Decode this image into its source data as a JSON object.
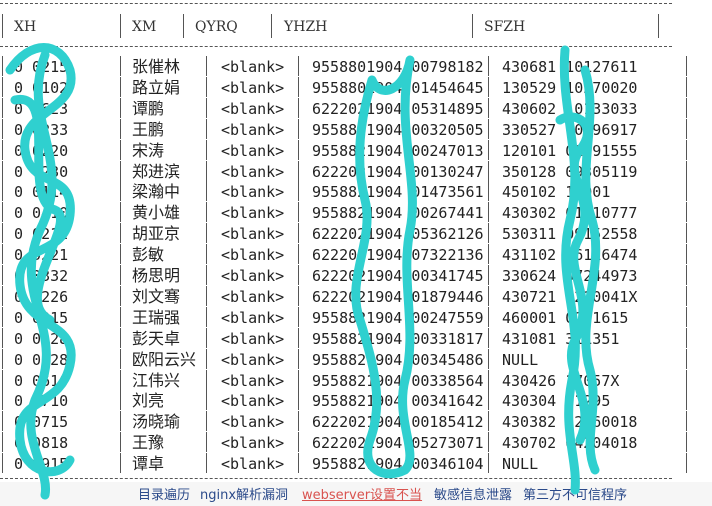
{
  "table": {
    "headers": [
      "XH",
      "XM",
      "QYRQ",
      "YHZH",
      "SFZH"
    ],
    "rows": [
      [
        "0  0215",
        "张催林",
        "<blank>",
        "9558801904 00798182",
        "430681   10127611"
      ],
      [
        "0  0102",
        "路立娟",
        "<blank>",
        "9558801904 01454645",
        "130529   10270020"
      ],
      [
        "0  0623",
        "谭鹏",
        "<blank>",
        "6222021904 05314895",
        "430602   10133033"
      ],
      [
        "0  0233",
        "王鹏",
        "<blank>",
        "9558821904 00320505",
        "330527   10296917"
      ],
      [
        "0  0220",
        "宋涛",
        "<blank>",
        "9558821904 00247013",
        "120101   01291555"
      ],
      [
        "0  0230",
        "郑进滨",
        "<blank>",
        "6222021904 00130247",
        "350128   09305119"
      ],
      [
        "0  0114",
        "梁瀚中",
        "<blank>",
        "9558821904 01473561",
        "450102   15001"
      ],
      [
        "0  0410",
        "黄小雄",
        "<blank>",
        "9558821904 00267441",
        "430302   01010777"
      ],
      [
        "0  0212",
        "胡亚京",
        "<blank>",
        "6222021904 05362126",
        "530311   09152558"
      ],
      [
        "0  0221",
        "彭敏",
        "<blank>",
        "6222021904 07322136",
        "431102   06116474"
      ],
      [
        "0  0332",
        "杨思明",
        "<blank>",
        "6222021904 00341745",
        "330624   07244973"
      ],
      [
        "0  0226",
        "刘文骞",
        "<blank>",
        "6222021904 01879446",
        "430721   0210041X"
      ],
      [
        "0  0215",
        "王瑞强",
        "<blank>",
        "9558821904 00247559",
        "460001   0261615"
      ],
      [
        "0  0428",
        "彭天卓",
        "<blank>",
        "9558821904 00331817",
        "431081   311351"
      ],
      [
        "0  0828",
        "欧阳云兴",
        "<blank>",
        "9558821904 00345486",
        "NULL"
      ],
      [
        "0  0616",
        "江伟兴",
        "<blank>",
        "9558821904 00338564",
        "430426   17057X"
      ],
      [
        "0  0710",
        "刘亮",
        "<blank>",
        "9558821904 00341642",
        "430304   01295"
      ],
      [
        "0  0715",
        "汤晓瑜",
        "<blank>",
        "6222021904 00185412",
        "430382   12060018"
      ],
      [
        "0  0818",
        "王豫",
        "<blank>",
        "6222021904 05273071",
        "430702   04204018"
      ],
      [
        "0  0915",
        "谭卓",
        "<blank>",
        "9558821904 00346104",
        "NULL"
      ]
    ]
  },
  "footer": {
    "links": [
      "目录遍历",
      "nginx解析漏洞",
      "webserver设置不当",
      "敏感信息泄露",
      "第三方不可信程序"
    ]
  },
  "colors": {
    "redaction": "#2fd0cf",
    "footer_link": "#2b4a8a",
    "footer_highlight": "#d9534f"
  }
}
